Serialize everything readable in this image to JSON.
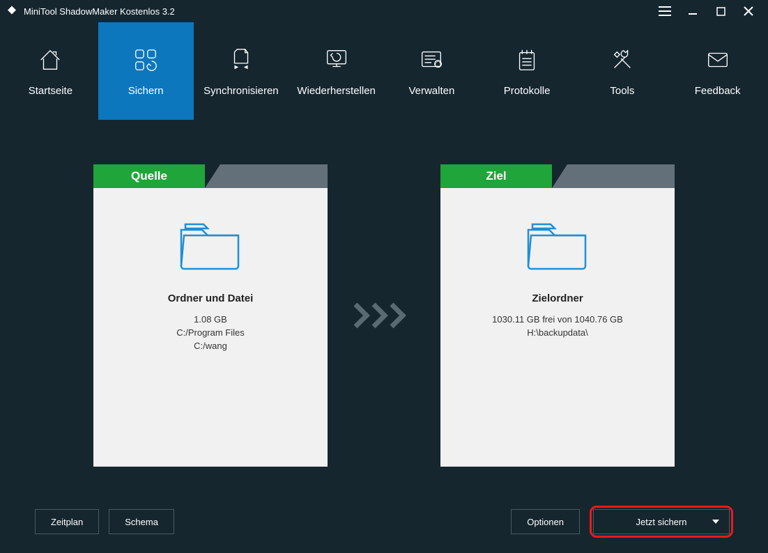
{
  "title": "MiniTool ShadowMaker Kostenlos 3.2",
  "nav": {
    "home": "Startseite",
    "backup": "Sichern",
    "sync": "Synchronisieren",
    "restore": "Wiederherstellen",
    "manage": "Verwalten",
    "logs": "Protokolle",
    "tools": "Tools",
    "feedback": "Feedback"
  },
  "source": {
    "tab": "Quelle",
    "title": "Ordner und Datei",
    "size": "1.08 GB",
    "path1": "C:/Program Files",
    "path2": "C:/wang"
  },
  "dest": {
    "tab": "Ziel",
    "title": "Zielordner",
    "info": "1030.11 GB frei von 1040.76 GB",
    "path": "H:\\backupdata\\"
  },
  "footer": {
    "schedule": "Zeitplan",
    "scheme": "Schema",
    "options": "Optionen",
    "backup_now": "Jetzt sichern"
  }
}
